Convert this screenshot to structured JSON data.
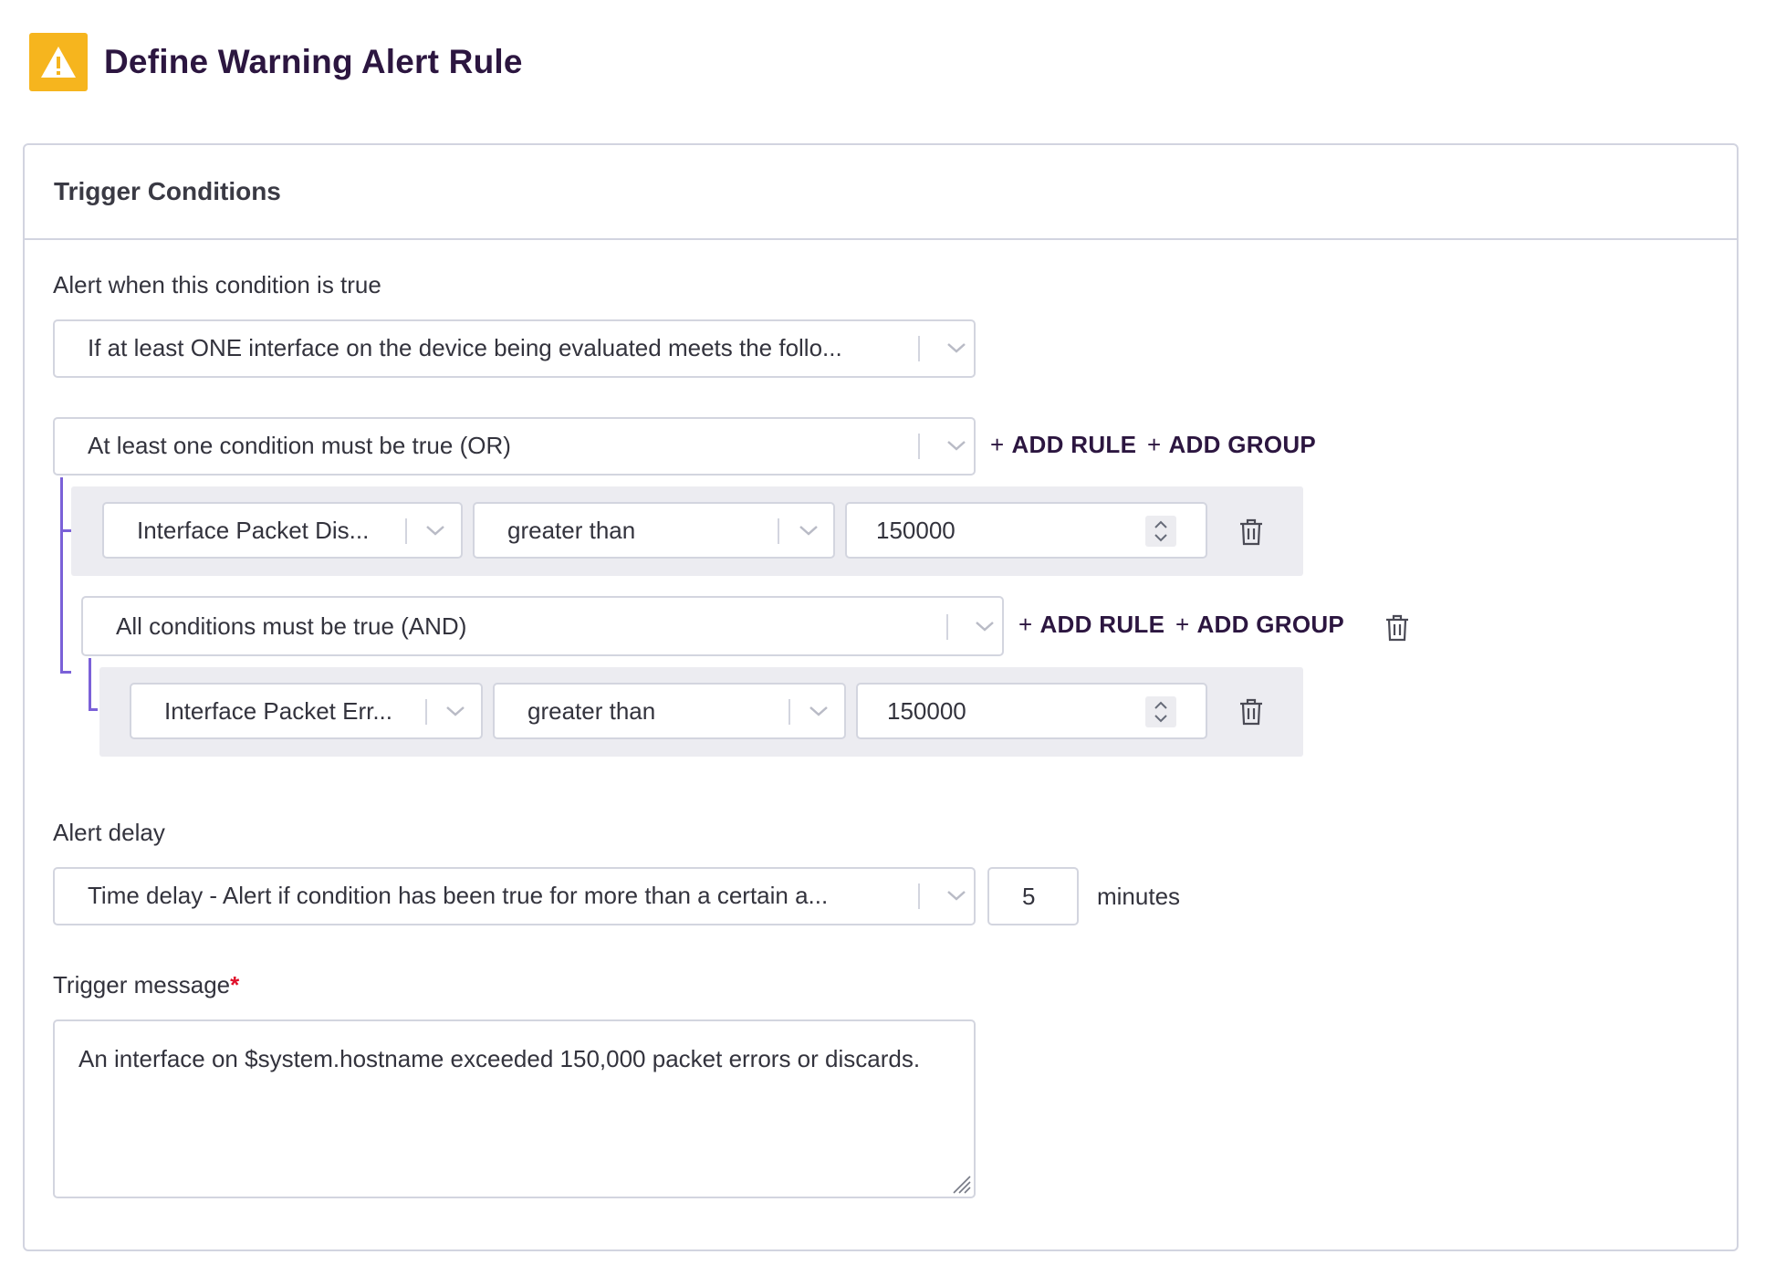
{
  "header": {
    "title": "Define Warning Alert Rule",
    "icon": "warning-icon",
    "accent": "#f6b51e"
  },
  "card": {
    "title": "Trigger Conditions"
  },
  "condition": {
    "label": "Alert when this condition is true",
    "scope_value": "If at least ONE interface on the device being evaluated meets the follo..."
  },
  "group_or": {
    "operator": "At least one condition must be true (OR)",
    "add_rule": "ADD RULE",
    "add_group": "ADD GROUP",
    "rule": {
      "metric": "Interface Packet Dis...",
      "comparator": "greater than",
      "value": "150000"
    }
  },
  "group_and": {
    "operator": "All conditions must be true (AND)",
    "add_rule": "ADD RULE",
    "add_group": "ADD GROUP",
    "rule": {
      "metric": "Interface Packet Err...",
      "comparator": "greater than",
      "value": "150000"
    }
  },
  "delay": {
    "label": "Alert delay",
    "type_value": "Time delay - Alert if condition has been true for more than a certain a...",
    "amount": "5",
    "unit": "minutes"
  },
  "message": {
    "label": "Trigger message",
    "required_mark": "*",
    "text": "An interface on $system.hostname exceeded 150,000 packet errors or discards."
  },
  "colors": {
    "brand_text": "#2c1640",
    "group_bracket": "#7b61d8",
    "required": "#e0112b"
  }
}
